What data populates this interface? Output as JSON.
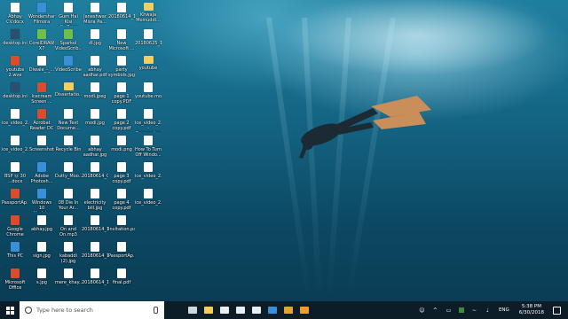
{
  "desktop_icons": [
    {
      "label": "Abhay\nCV.docx",
      "kind": "doc"
    },
    {
      "label": "desktop.ini",
      "kind": "dark"
    },
    {
      "label": "youtube\n2.wve",
      "kind": "app2"
    },
    {
      "label": "desktop.ini",
      "kind": "dark"
    },
    {
      "label": "ice_video_2...",
      "kind": "doc"
    },
    {
      "label": "ice_video_2...",
      "kind": "doc"
    },
    {
      "label": "BSP ㉤ 30\n...docx",
      "kind": "doc"
    },
    {
      "label": "PassportAp...",
      "kind": "app2"
    },
    {
      "label": "Google\nChrome",
      "kind": "app2"
    },
    {
      "label": "This PC",
      "kind": "app"
    },
    {
      "label": "Microsoft\nOffice",
      "kind": "app2"
    },
    {
      "label": "Wondershare\nFilmora",
      "kind": "app"
    },
    {
      "label": "CorelDRAW\nX7",
      "kind": "app3"
    },
    {
      "label": "Diwale_-_...",
      "kind": "doc"
    },
    {
      "label": "Icecream\nScreen ...",
      "kind": "app2"
    },
    {
      "label": "Acrobat\nReader DC",
      "kind": "app2"
    },
    {
      "label": "Screenshot",
      "kind": "doc"
    },
    {
      "label": "Adobe\nPhotosh...",
      "kind": "app"
    },
    {
      "label": "Windows 10\nUpdate As...",
      "kind": "app"
    },
    {
      "label": "abhay.jpg",
      "kind": "doc"
    },
    {
      "label": "sign.jpg",
      "kind": "doc"
    },
    {
      "label": "s.jpg",
      "kind": "doc"
    },
    {
      "label": "Gum Hai Kisi\nKe Pyar Me...",
      "kind": "doc"
    },
    {
      "label": "Sparkol\nVideoScrib...",
      "kind": "app3"
    },
    {
      "label": "VideoScribe",
      "kind": "app"
    },
    {
      "label": "Dissertatio...",
      "kind": "folder"
    },
    {
      "label": "New Text\nDocume...",
      "kind": "doc"
    },
    {
      "label": "Recycle Bin",
      "kind": "doc"
    },
    {
      "label": "Dutty_Moo...",
      "kind": "doc"
    },
    {
      "label": "08 Die In\nYour Ar...",
      "kind": "doc"
    },
    {
      "label": "On and\nOn.mp3",
      "kind": "doc"
    },
    {
      "label": "kabaddi\n(2).jpg",
      "kind": "doc"
    },
    {
      "label": "mere_khay...",
      "kind": "doc"
    },
    {
      "label": "Janeshwar\nMisra Pa...",
      "kind": "doc"
    },
    {
      "label": "dl.jpg",
      "kind": "doc"
    },
    {
      "label": "abhay\naadhar.pdf",
      "kind": "doc"
    },
    {
      "label": "modi.jpeg",
      "kind": "doc"
    },
    {
      "label": "modi.jpg",
      "kind": "doc"
    },
    {
      "label": "abhay\naadhar.jpg",
      "kind": "doc"
    },
    {
      "label": "20180614_0...",
      "kind": "doc"
    },
    {
      "label": "electricity\nbill.jpg",
      "kind": "doc"
    },
    {
      "label": "20180614_1...",
      "kind": "doc"
    },
    {
      "label": "20180614_1...",
      "kind": "doc"
    },
    {
      "label": "20180614_1...",
      "kind": "doc"
    },
    {
      "label": "20180614_1...",
      "kind": "doc"
    },
    {
      "label": "New\nMicrosoft ...",
      "kind": "doc"
    },
    {
      "label": "party\nsymbols.jpg",
      "kind": "doc"
    },
    {
      "label": "page 1\ncopy.PDF",
      "kind": "doc"
    },
    {
      "label": "page 2\ncopy.pdf",
      "kind": "doc"
    },
    {
      "label": "modi.png",
      "kind": "doc"
    },
    {
      "label": "page 3\ncopy.pdf",
      "kind": "doc"
    },
    {
      "label": "page 4\ncopy.pdf",
      "kind": "doc"
    },
    {
      "label": "Invitation.pdf",
      "kind": "doc"
    },
    {
      "label": "PassportAp...",
      "kind": "doc"
    },
    {
      "label": "final.pdf",
      "kind": "doc"
    },
    {
      "label": "Khwaja\nMoinuddi...",
      "kind": "folder"
    },
    {
      "label": "20180625_1...",
      "kind": "doc"
    },
    {
      "label": "youtube",
      "kind": "folder"
    },
    {
      "label": "youtube.mov",
      "kind": "doc"
    },
    {
      "label": "ice_video_2...\n- Copy.webm",
      "kind": "doc"
    },
    {
      "label": "How To Turn\nOff Windo...",
      "kind": "doc"
    },
    {
      "label": "ice_video_2...",
      "kind": "doc"
    },
    {
      "label": "ice_video_2...",
      "kind": "doc"
    }
  ],
  "taskbar": {
    "search_placeholder": "Type here to search",
    "pinned": [
      {
        "name": "task-view-icon",
        "color": "#cfd8de"
      },
      {
        "name": "file-explorer-icon",
        "color": "#f2cf5b"
      },
      {
        "name": "store-icon",
        "color": "#e8eef2"
      },
      {
        "name": "mail-icon",
        "color": "#e8eef2"
      },
      {
        "name": "groove-icon",
        "color": "#e8eef2"
      },
      {
        "name": "edge-icon",
        "color": "#3a8fd9"
      },
      {
        "name": "chrome-icon",
        "color": "#e0a52b"
      },
      {
        "name": "app-icon",
        "color": "#f39c2a"
      }
    ],
    "language": "ENG",
    "time": "5:38 PM",
    "date": "6/30/2018"
  }
}
